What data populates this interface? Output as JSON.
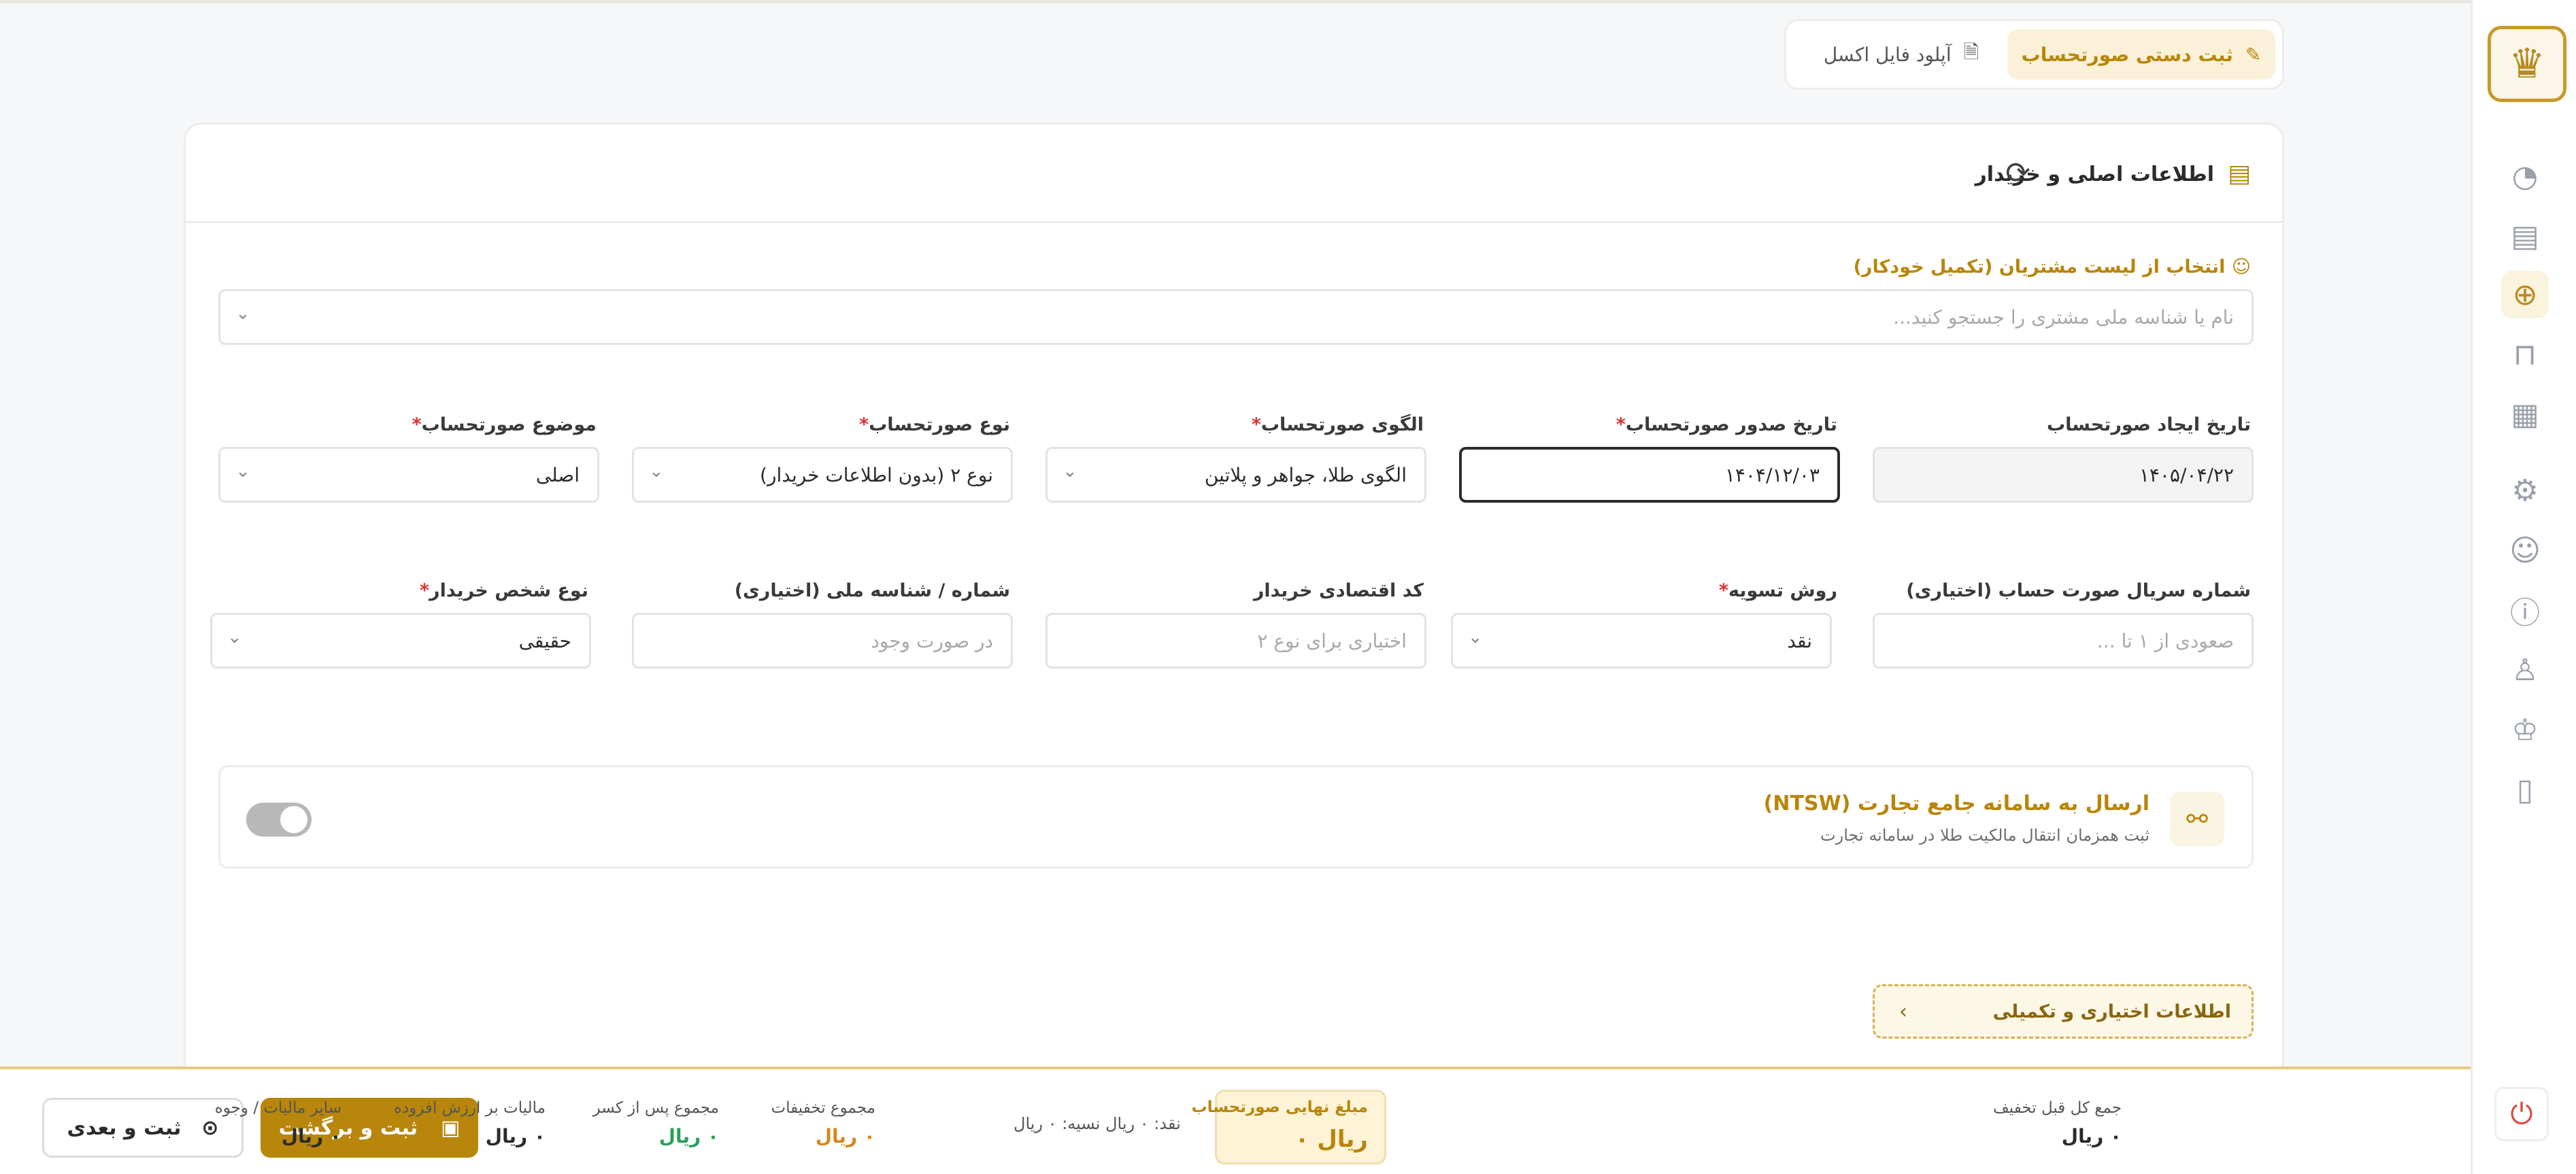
{
  "tabs": {
    "manual": {
      "label": "ثبت دستی صورتحساب",
      "icon": "edit-icon"
    },
    "excel": {
      "label": "آپلود فایل اکسل",
      "icon": "file-excel-icon"
    }
  },
  "section": {
    "title": "اطلاعات اصلی و خریدار"
  },
  "customer": {
    "label": "انتخاب از لیست مشتریان (تکمیل خودکار)",
    "placeholder": "نام یا شناسه ملی مشتری را جستجو کنید..."
  },
  "fields": {
    "created_date": {
      "label": "تاریخ ایجاد صورتحساب",
      "value": "۱۴۰۵/۰۴/۲۲"
    },
    "issue_date": {
      "label": "تاریخ صدور صورتحساب",
      "value": "۱۴۰۴/۱۲/۰۳"
    },
    "pattern": {
      "label": "الگوی صورتحساب",
      "value": "الگوی طلا، جواهر و پلاتین"
    },
    "type": {
      "label": "نوع صورتحساب",
      "value": "نوع ۲ (بدون اطلاعات خریدار)"
    },
    "subject": {
      "label": "موضوع صورتحساب",
      "value": "اصلی"
    },
    "serial": {
      "label": "شماره سریال صورت حساب (اختیاری)",
      "placeholder": "صعودی از ۱ تا ..."
    },
    "settlement": {
      "label": "روش تسویه",
      "value": "نقد"
    },
    "economic_code": {
      "label": "کد اقتصادی خریدار",
      "placeholder": "اختیاری برای نوع ۲"
    },
    "national_id": {
      "label": "شماره / شناسه ملی (اختیاری)",
      "placeholder": "در صورت وجود"
    },
    "buyer_type": {
      "label": "نوع شخص خریدار",
      "value": "حقیقی"
    }
  },
  "ntsw": {
    "title": "ارسال به سامانه جامع تجارت (NTSW)",
    "subtitle": "ثبت همزمان انتقال مالکیت طلا در سامانه تجارت",
    "enabled": false
  },
  "optional_section": {
    "label": "اطلاعات اختیاری و تکمیلی"
  },
  "footer": {
    "summary": [
      {
        "title": "جمع کل قبل تخفیف",
        "value": "۰ ریال",
        "color": "#2b2b2b"
      },
      {
        "title": "مجموع تخفیفات",
        "value": "۰ ریال",
        "color": "#d4881c"
      },
      {
        "title": "مجموع پس از کسر",
        "value": "۰ ریال",
        "color": "#2e9e5a"
      },
      {
        "title": "مالیات بر ارزش افزوده",
        "value": "۰ ریال",
        "color": "#2b2b2b"
      },
      {
        "title": "سایر مالیات / وجوه",
        "value": "۰ ریال",
        "color": "#2b2b2b"
      }
    ],
    "final": {
      "title": "مبلغ نهایی صورتحساب",
      "value": "۰ ریال"
    },
    "cash_note": "نقد: ۰ ریال  نسیه: ۰ ریال",
    "save_back_label": "ثبت و برگشت",
    "save_next_label": "ثبت و بعدی"
  },
  "colors": {
    "accent": "#b8860b",
    "accent_light": "#faf1d8",
    "danger": "#e03030"
  }
}
